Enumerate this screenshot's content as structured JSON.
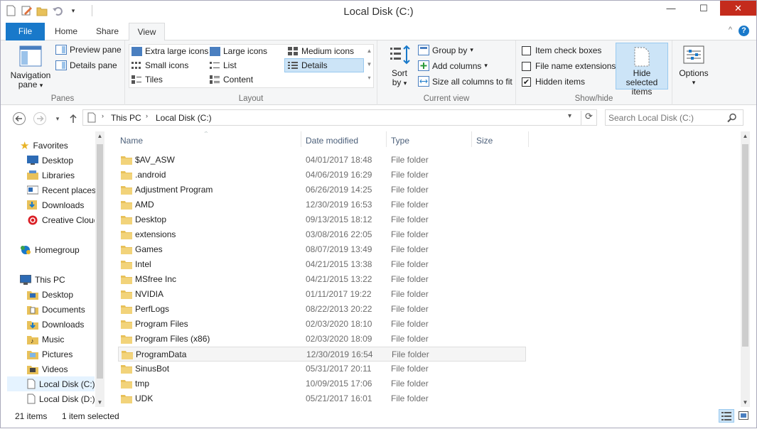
{
  "window": {
    "title": "Local Disk (C:)",
    "minimize": "—",
    "maximize": "☐",
    "close": "✕"
  },
  "tabs": [
    {
      "label": "File"
    },
    {
      "label": "Home"
    },
    {
      "label": "Share"
    },
    {
      "label": "View"
    }
  ],
  "ribbon": {
    "panes": {
      "navigation_pane_line1": "Navigation",
      "navigation_pane_line2": "pane",
      "preview_pane": "Preview pane",
      "details_pane": "Details pane",
      "label": "Panes"
    },
    "layout": {
      "items": [
        "Extra large icons",
        "Large icons",
        "Medium icons",
        "Small icons",
        "List",
        "Details",
        "Tiles",
        "Content"
      ],
      "selected": "Details",
      "label": "Layout"
    },
    "current_view": {
      "sort_by_line1": "Sort",
      "sort_by_line2": "by",
      "group_by": "Group by",
      "add_columns": "Add columns",
      "size_all_columns": "Size all columns to fit",
      "label": "Current view"
    },
    "show_hide": {
      "item_check_boxes": "Item check boxes",
      "file_name_extensions": "File name extensions",
      "hidden_items": "Hidden items",
      "hidden_items_checked": true,
      "hide_selected_line1": "Hide selected",
      "hide_selected_line2": "items",
      "label": "Show/hide"
    },
    "options": {
      "label": "Options"
    }
  },
  "address": {
    "crumbs": [
      "This PC",
      "Local Disk (C:)"
    ],
    "search_placeholder": "Search Local Disk (C:)"
  },
  "nav": {
    "favorites": {
      "label": "Favorites",
      "items": [
        "Desktop",
        "Libraries",
        "Recent places",
        "Downloads",
        "Creative Cloud"
      ]
    },
    "homegroup": "Homegroup",
    "this_pc": {
      "label": "This PC",
      "items": [
        "Desktop",
        "Documents",
        "Downloads",
        "Music",
        "Pictures",
        "Videos",
        "Local Disk (C:)",
        "Local Disk (D:)"
      ],
      "selected": "Local Disk (C:)"
    }
  },
  "columns": {
    "name": "Name",
    "date": "Date modified",
    "type": "Type",
    "size": "Size"
  },
  "files": [
    {
      "name": "$AV_ASW",
      "date": "04/01/2017 18:48",
      "type": "File folder"
    },
    {
      "name": ".android",
      "date": "04/06/2019 16:29",
      "type": "File folder"
    },
    {
      "name": "Adjustment Program",
      "date": "06/26/2019 14:25",
      "type": "File folder"
    },
    {
      "name": "AMD",
      "date": "12/30/2019 16:53",
      "type": "File folder"
    },
    {
      "name": "Desktop",
      "date": "09/13/2015 18:12",
      "type": "File folder"
    },
    {
      "name": "extensions",
      "date": "03/08/2016 22:05",
      "type": "File folder"
    },
    {
      "name": "Games",
      "date": "08/07/2019 13:49",
      "type": "File folder"
    },
    {
      "name": "Intel",
      "date": "04/21/2015 13:38",
      "type": "File folder"
    },
    {
      "name": "MSfree Inc",
      "date": "04/21/2015 13:22",
      "type": "File folder"
    },
    {
      "name": "NVIDIA",
      "date": "01/11/2017 19:22",
      "type": "File folder"
    },
    {
      "name": "PerfLogs",
      "date": "08/22/2013 20:22",
      "type": "File folder"
    },
    {
      "name": "Program Files",
      "date": "02/03/2020 18:10",
      "type": "File folder"
    },
    {
      "name": "Program Files (x86)",
      "date": "02/03/2020 18:09",
      "type": "File folder"
    },
    {
      "name": "ProgramData",
      "date": "12/30/2019 16:54",
      "type": "File folder",
      "selected": true
    },
    {
      "name": "SinusBot",
      "date": "05/31/2017 20:11",
      "type": "File folder"
    },
    {
      "name": "tmp",
      "date": "10/09/2015 17:06",
      "type": "File folder"
    },
    {
      "name": "UDK",
      "date": "05/21/2017 16:01",
      "type": "File folder"
    }
  ],
  "status": {
    "count": "21 items",
    "selected": "1 item selected"
  },
  "colors": {
    "accent": "#1979ca",
    "folder": "#e8c15a",
    "selection": "#cce4f7"
  }
}
